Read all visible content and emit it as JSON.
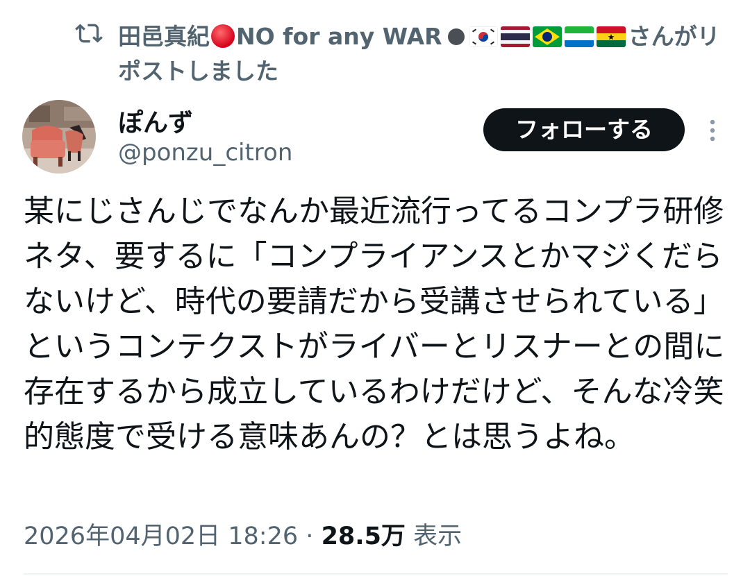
{
  "repost": {
    "icon": "repost-icon",
    "reposter_name": "田邑真紀",
    "reposter_tag": "NO for any WAR",
    "flags": [
      "KR",
      "TH",
      "BR",
      "SL",
      "GH"
    ],
    "action_text": "さんがリポストしました"
  },
  "author": {
    "display_name": "ぽんず",
    "handle": "@ponzu_citron"
  },
  "follow_button": {
    "label": "フォローする"
  },
  "more_icon": "more-vertical-icon",
  "tweet": {
    "text": "某にじさんじでなんか最近流行ってるコンプラ研修ネタ、要するに「コンプライアンスとかマジくだらないけど、時代の要請だから受講させられている」というコンテクストがライバーとリスナーとの間に存在するから成立しているわけだけど、そんな冷笑的態度で受ける意味あんの？とは思うよね。"
  },
  "meta": {
    "timestamp": "2026年04月02日 18:26",
    "separator": "·",
    "views_count": "28.5万",
    "views_label": "表示"
  },
  "colors": {
    "text": "#0f1419",
    "secondary": "#536471",
    "button_bg": "#0f1419",
    "button_text": "#ffffff",
    "divider": "#eff3f4"
  }
}
